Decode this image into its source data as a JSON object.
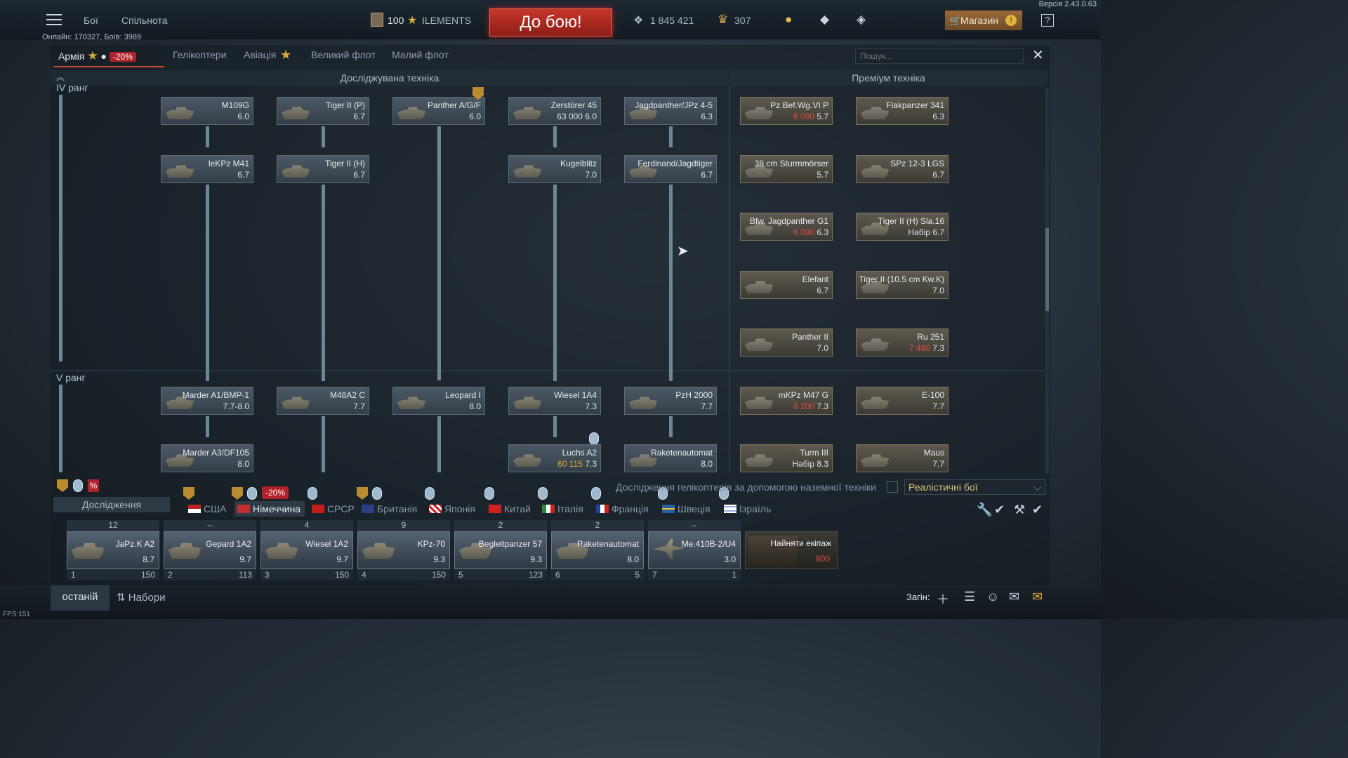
{
  "version": "Версія 2.43.0.63",
  "online": "Онлайн: 170327, Боїв: 3989",
  "nav": {
    "battles": "Бої",
    "community": "Спільнота"
  },
  "player": {
    "level": "100",
    "name": "ILEMENTS"
  },
  "battle_btn": "До бою!",
  "silver": "1 845 421",
  "gold": "307",
  "shop": "Магазин",
  "help": "?",
  "tabs": {
    "army": "Армія",
    "army_discount": "-20%",
    "heli": "Гелікоптери",
    "aviation": "Авіація",
    "bigfleet": "Великий флот",
    "smallfleet": "Малий флот"
  },
  "search_placeholder": "Пошук...",
  "headers": {
    "researched": "Досліджувана техніка",
    "premium": "Преміум техніка"
  },
  "ranks": {
    "iv": "IV ранг",
    "v": "V ранг"
  },
  "tree": [
    {
      "name": "M109G",
      "br": "6.0"
    },
    {
      "name": "Tiger II (P)",
      "br": "6.7"
    },
    {
      "name": "Panther A/G/F",
      "br": "6.0"
    },
    {
      "name": "Zerstörer 45",
      "price": "63 000",
      "br": "6.0"
    },
    {
      "name": "Jagdpanther/JPz 4-5",
      "br": "6.3"
    },
    {
      "name": "leKPz M41",
      "br": "6.7"
    },
    {
      "name": "Tiger II (H)",
      "br": "6.7"
    },
    {
      "name": "Kugelblitz",
      "br": "7.0"
    },
    {
      "name": "Ferdinand/Jagdtiger",
      "br": "6.7"
    },
    {
      "name": "Marder A1/BMP-1",
      "br": "7.7-8.0"
    },
    {
      "name": "M48A2 C",
      "br": "7.7"
    },
    {
      "name": "Leopard I",
      "br": "8.0"
    },
    {
      "name": "Wiesel 1A4",
      "br": "7.3"
    },
    {
      "name": "PzH 2000",
      "br": "7.7"
    },
    {
      "name": "Marder A3/DF105",
      "br": "8.0"
    },
    {
      "name": "Luchs A2",
      "price": "60 115",
      "br": "7.3"
    },
    {
      "name": "Raketenautomat",
      "br": "8.0"
    }
  ],
  "premium": [
    {
      "name": "Pz.Bef.Wg.VI P",
      "price": "6 090",
      "br": "5.7"
    },
    {
      "name": "Flakpanzer 341",
      "br": "6.3"
    },
    {
      "name": "38 cm Sturmmörser",
      "br": "5.7"
    },
    {
      "name": "SPz 12-3 LGS",
      "br": "6.7"
    },
    {
      "name": "Bfw. Jagdpanther G1",
      "price": "6 090",
      "br": "6.3"
    },
    {
      "name": "Tiger II (H) Sla.16",
      "price": "Набір",
      "br": "6.7"
    },
    {
      "name": "Elefant",
      "br": "6.7"
    },
    {
      "name": "Tiger II (10.5 cm Kw.K)",
      "br": "7.0"
    },
    {
      "name": "Panther II",
      "br": "7.0"
    },
    {
      "name": "Ru 251",
      "price": "7 480",
      "br": "7.3"
    },
    {
      "name": "mKPz M47 G",
      "price": "8 200",
      "br": "7.3"
    },
    {
      "name": "E-100",
      "br": "7.7"
    },
    {
      "name": "Turm III",
      "price": "Набір",
      "br": "8.3"
    },
    {
      "name": "Maus",
      "br": "7.7"
    }
  ],
  "heli_research": "Дослідження гелікоптерів за допомогою наземної техніки",
  "mode": "Реалістичні бої",
  "research_label": "Дослідження",
  "nation_discount": "-20%",
  "nations": [
    "США",
    "Німеччина",
    "СРСР",
    "Британія",
    "Японія",
    "Китай",
    "Італія",
    "Франція",
    "Швеція",
    "Ізраїль"
  ],
  "crew": [
    {
      "count": "12",
      "name": "JaPz.K A2",
      "br": "8.7",
      "num": "1",
      "val": "150"
    },
    {
      "count": "–",
      "name": "Gepard 1A2",
      "br": "9.7",
      "num": "2",
      "val": "113"
    },
    {
      "count": "4",
      "name": "Wiesel 1A2",
      "br": "9.7",
      "num": "3",
      "val": "150"
    },
    {
      "count": "9",
      "name": "KPz-70",
      "br": "9.3",
      "num": "4",
      "val": "150"
    },
    {
      "count": "2",
      "name": "Begleitpanzer 57",
      "br": "9.3",
      "num": "5",
      "val": "123"
    },
    {
      "count": "2",
      "name": "Raketenautomat",
      "br": "8.0",
      "num": "6",
      "val": "5"
    },
    {
      "count": "–",
      "name": "Me.410B-2/U4",
      "br": "3.0",
      "num": "7",
      "val": "1"
    }
  ],
  "hire_crew": {
    "label": "Найняти екіпаж",
    "price": "800"
  },
  "bottom": {
    "last": "останій",
    "presets": "Набори",
    "camo": "Загін:"
  },
  "fps": "FPS:151"
}
